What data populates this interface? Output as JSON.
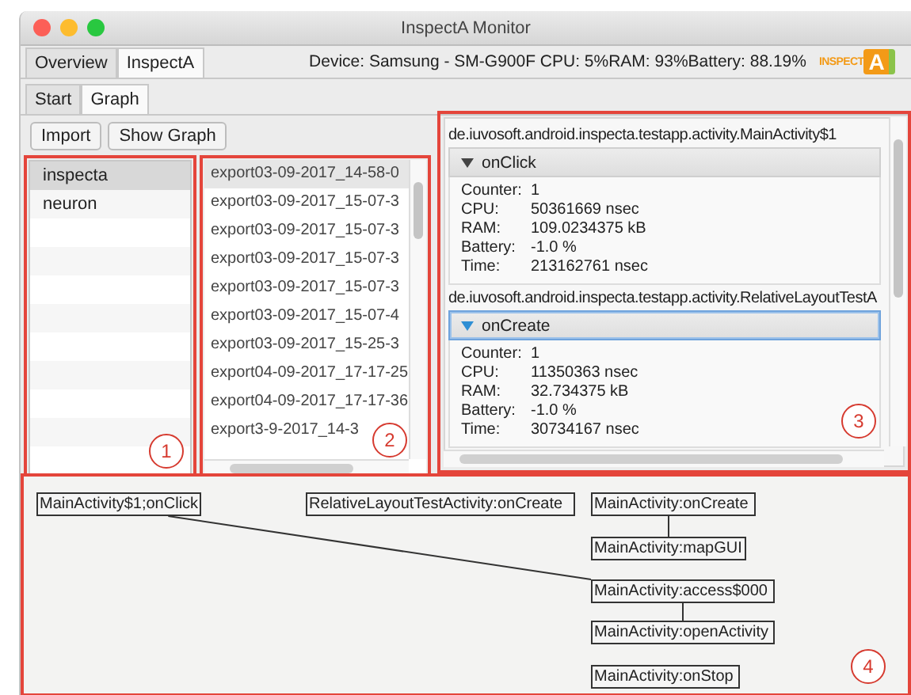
{
  "window": {
    "title": "InspectA Monitor"
  },
  "main_tabs": [
    {
      "label": "Overview",
      "selected": false
    },
    {
      "label": "InspectA",
      "selected": true
    }
  ],
  "status": "Device: Samsung - SM-G900F   CPU: 5%RAM: 93%Battery: 88.19%",
  "logo": {
    "text": "INSPECT",
    "mark": "A"
  },
  "sub_tabs": [
    {
      "label": "Start",
      "selected": false
    },
    {
      "label": "Graph",
      "selected": true
    }
  ],
  "buttons": [
    "Import",
    "Show Graph"
  ],
  "apps": [
    {
      "label": "inspecta",
      "selected": true
    },
    {
      "label": "neuron",
      "selected": false
    }
  ],
  "exports": [
    {
      "label": "export03-09-2017_14-58-0",
      "selected": true
    },
    {
      "label": "export03-09-2017_15-07-3",
      "selected": false
    },
    {
      "label": "export03-09-2017_15-07-3",
      "selected": false
    },
    {
      "label": "export03-09-2017_15-07-3",
      "selected": false
    },
    {
      "label": "export03-09-2017_15-07-3",
      "selected": false
    },
    {
      "label": "export03-09-2017_15-07-4",
      "selected": false
    },
    {
      "label": "export03-09-2017_15-25-3",
      "selected": false
    },
    {
      "label": "export04-09-2017_17-17-25",
      "selected": false
    },
    {
      "label": "export04-09-2017_17-17-36",
      "selected": false
    },
    {
      "label": "export3-9-2017_14-3",
      "selected": false
    }
  ],
  "details": [
    {
      "class_name": "de.iuvosoft.android.inspecta.testapp.activity.MainActivity$1",
      "method": "onClick",
      "expanded": true,
      "focused": false,
      "fields": [
        {
          "label": "Counter:",
          "value": "1"
        },
        {
          "label": "CPU:",
          "value": "50361669 nsec"
        },
        {
          "label": "RAM:",
          "value": "109.0234375 kB"
        },
        {
          "label": "Battery:",
          "value": "-1.0 %"
        },
        {
          "label": "Time:",
          "value": "213162761 nsec"
        }
      ]
    },
    {
      "class_name": "de.iuvosoft.android.inspecta.testapp.activity.RelativeLayoutTestA",
      "method": "onCreate",
      "expanded": true,
      "focused": true,
      "fields": [
        {
          "label": "Counter:",
          "value": "1"
        },
        {
          "label": "CPU:",
          "value": "11350363 nsec"
        },
        {
          "label": "RAM:",
          "value": "32.734375 kB"
        },
        {
          "label": "Battery:",
          "value": "-1.0 %"
        },
        {
          "label": "Time:",
          "value": "30734167 nsec"
        }
      ]
    }
  ],
  "graph": {
    "nodes": [
      {
        "label": "MainActivity$1;onClick",
        "children": [
          {
            "label": "MainActivity:access$000",
            "children": [
              {
                "label": "MainActivity:openActivity"
              }
            ]
          }
        ]
      },
      {
        "label": "RelativeLayoutTestActivity:onCreate"
      },
      {
        "label": "MainActivity:onCreate",
        "children": [
          {
            "label": "MainActivity:mapGUI"
          }
        ]
      },
      {
        "label": "MainActivity:onStop"
      }
    ]
  },
  "callouts": [
    "1",
    "2",
    "3",
    "4"
  ]
}
